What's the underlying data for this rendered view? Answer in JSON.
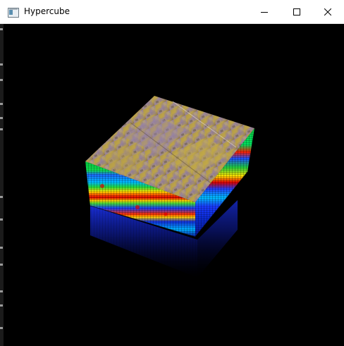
{
  "window": {
    "title": "Hypercube",
    "icon": "window-app-icon",
    "controls": {
      "minimize": "minimize-icon",
      "maximize": "maximize-icon",
      "close": "close-icon"
    }
  },
  "scene": {
    "description_icon": "hypercube-3d-render",
    "background_color": "#000000",
    "top_face_colors": [
      "#8a7a9e",
      "#b89a7a",
      "#c8b040",
      "#a89070"
    ],
    "side_band_colors": [
      "#0a1aa0",
      "#1a3aff",
      "#00c8ff",
      "#00e050",
      "#ffe000",
      "#ff4000",
      "#e00000"
    ]
  }
}
